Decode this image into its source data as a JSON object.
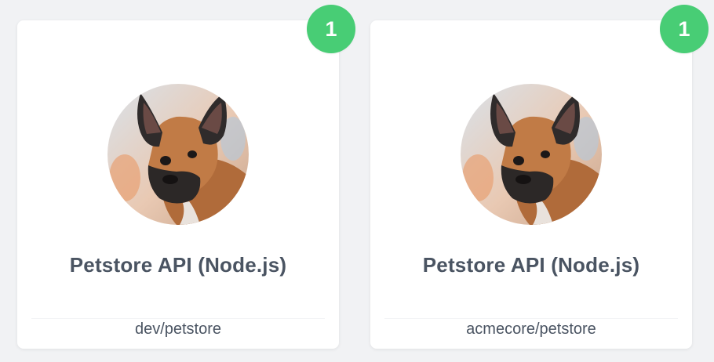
{
  "colors": {
    "background": "#f1f2f4",
    "card": "#ffffff",
    "text": "#4a5462",
    "badge": "#48cd75"
  },
  "cards": [
    {
      "title": "Petstore API (Node.js)",
      "subtitle": "dev/petstore",
      "badge_count": "1",
      "avatar_icon": "dog-avatar"
    },
    {
      "title": "Petstore API (Node.js)",
      "subtitle": "acmecore/petstore",
      "badge_count": "1",
      "avatar_icon": "dog-avatar"
    }
  ]
}
